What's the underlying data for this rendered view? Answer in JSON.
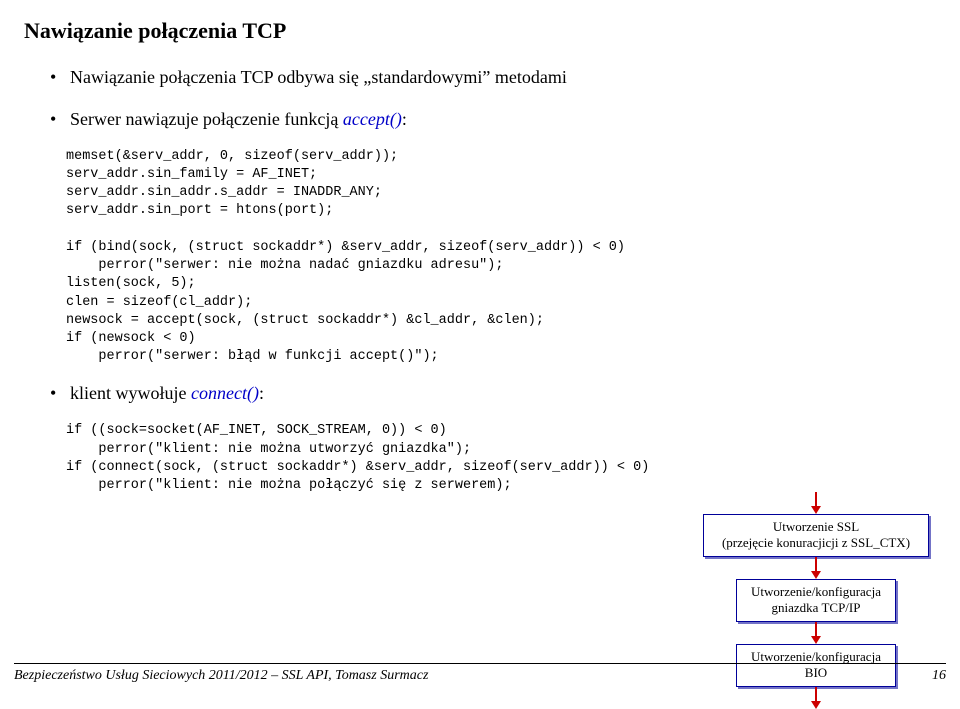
{
  "title": "Nawiązanie połączenia TCP",
  "bullets": {
    "b1": "Nawiązanie połączenia TCP odbywa się „standardowymi” metodami",
    "b2_pre": "Serwer nawiązuje połączenie funkcją ",
    "b2_func": "accept()",
    "b2_post": ":",
    "b3_pre": "klient wywołuje ",
    "b3_func": "connect()",
    "b3_post": ":"
  },
  "code1": "memset(&serv_addr, 0, sizeof(serv_addr));\nserv_addr.sin_family = AF_INET;\nserv_addr.sin_addr.s_addr = INADDR_ANY;\nserv_addr.sin_port = htons(port);\n\nif (bind(sock, (struct sockaddr*) &serv_addr, sizeof(serv_addr)) < 0)\n    perror(\"serwer: nie można nadać gniazdku adresu\");\nlisten(sock, 5);\nclen = sizeof(cl_addr);\nnewsock = accept(sock, (struct sockaddr*) &cl_addr, &clen);\nif (newsock < 0)\n    perror(\"serwer: błąd w funkcji accept()\");",
  "code2": "if ((sock=socket(AF_INET, SOCK_STREAM, 0)) < 0)\n    perror(\"klient: nie można utworzyć gniazdka\");\nif (connect(sock, (struct sockaddr*) &serv_addr, sizeof(serv_addr)) < 0)\n    perror(\"klient: nie można połączyć się z serwerem);",
  "boxes": {
    "ssl1_l1": "Utworzenie SSL",
    "ssl1_l2": "(przejęcie konuracjicji z SSL_CTX)",
    "ssl2_l1": "Utworzenie/konfiguracja",
    "ssl2_l2": "gniazdka TCP/IP",
    "ssl3_l1": "Utworzenie/konfiguracja",
    "ssl3_l2": "BIO"
  },
  "footer": {
    "left": "Bezpieczeństwo Usług Sieciowych 2011/2012 – SSL API, Tomasz Surmacz",
    "right": "16"
  }
}
